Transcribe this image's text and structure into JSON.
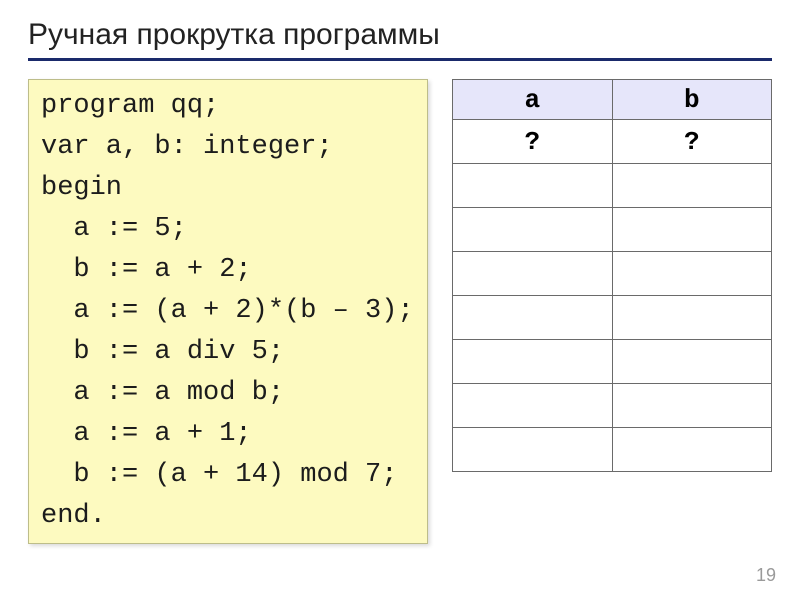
{
  "title": "Ручная прокрутка программы",
  "code": {
    "l1": "program qq;",
    "l2": "var a, b: integer;",
    "l3": "begin",
    "l4": "  a := 5;",
    "l5": "  b := a + 2;",
    "l6": "  a := (a + 2)*(b – 3);",
    "l7": "  b := a div 5;",
    "l8": "  a := a mod b;",
    "l9": "  a := a + 1;",
    "l10": "  b := (a + 14) mod 7;",
    "l11": "end."
  },
  "table": {
    "headers": {
      "a": "a",
      "b": "b"
    },
    "rows": [
      {
        "a": "?",
        "b": "?"
      },
      {
        "a": "",
        "b": ""
      },
      {
        "a": "",
        "b": ""
      },
      {
        "a": "",
        "b": ""
      },
      {
        "a": "",
        "b": ""
      },
      {
        "a": "",
        "b": ""
      },
      {
        "a": "",
        "b": ""
      },
      {
        "a": "",
        "b": ""
      }
    ]
  },
  "page_number": "19"
}
